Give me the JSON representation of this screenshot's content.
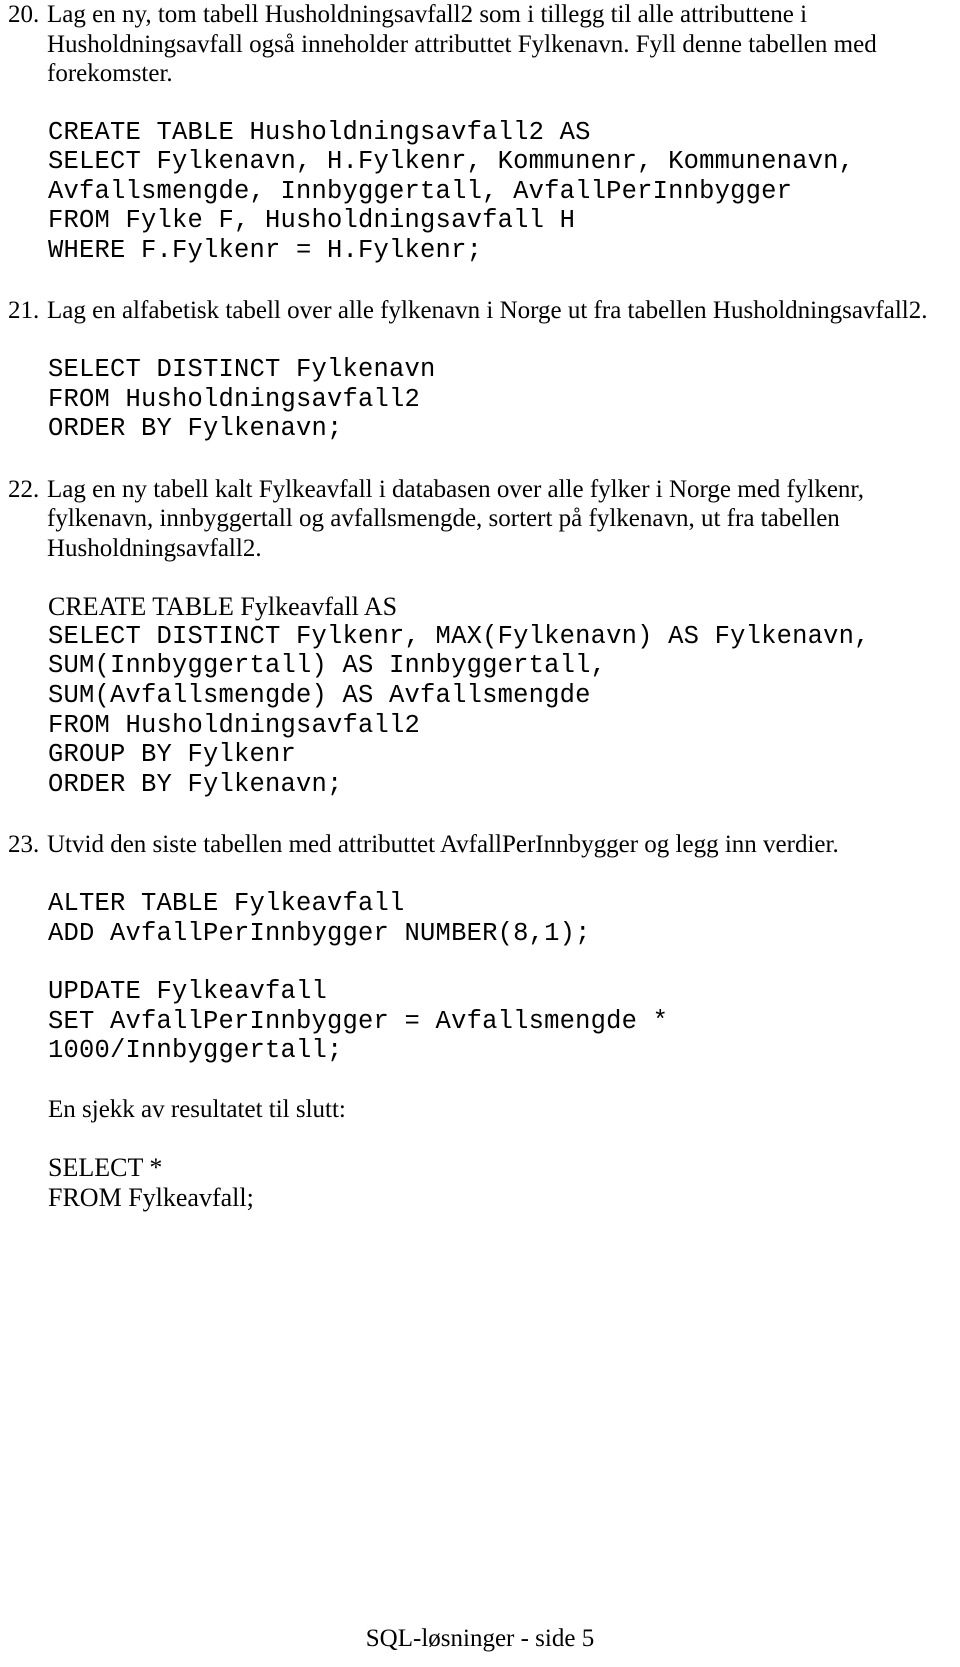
{
  "document": {
    "footer_text": "SQL-løsninger - side 5",
    "text_color": "#000000",
    "background_color": "#ffffff"
  },
  "items": [
    {
      "number": "20.",
      "prompt_lines": [
        "Lag en ny, tom tabell Husholdningsavfall2 som i tillegg til alle attributtene i",
        "Husholdningsavfall også inneholder attributtet Fylkenavn. Fyll denne tabellen",
        "med forekomster."
      ],
      "prompt": "Lag en ny, tom tabell Husholdningsavfall2 som i tillegg til alle attributtene i Husholdningsavfall også inneholder attributtet Fylkenavn. Fyll denne tabellen med forekomster.",
      "code": "CREATE TABLE Husholdningsavfall2 AS\nSELECT Fylkenavn, H.Fylkenr, Kommunenr, Kommunenavn,\nAvfallsmengde, Innbyggertall, AvfallPerInnbygger\nFROM Fylke F, Husholdningsavfall H\nWHERE F.Fylkenr = H.Fylkenr;"
    },
    {
      "number": "21.",
      "prompt_lines": [
        "Lag en alfabetisk tabell over alle fylkenavn i Norge ut fra tabellen",
        "Husholdningsavfall2."
      ],
      "prompt": "Lag en alfabetisk tabell over alle fylkenavn i Norge ut fra tabellen Husholdningsavfall2.",
      "code": "SELECT DISTINCT Fylkenavn\nFROM Husholdningsavfall2\nORDER BY Fylkenavn;"
    },
    {
      "number": "22.",
      "prompt_lines": [
        "Lag en ny tabell kalt Fylkeavfall i databasen over alle fylker i Norge med fylkenr,",
        "fylkenavn, innbyggertall og avfallsmengde, sortert på fylkenavn, ut fra tabellen",
        "Husholdningsavfall2."
      ],
      "prompt": "Lag en ny tabell kalt Fylkeavfall i databasen over alle fylker i Norge med fylkenr, fylkenavn, innbyggertall og avfallsmengde, sortert på fylkenavn, ut fra tabellen Husholdningsavfall2.",
      "code_header": "CREATE TABLE Fylkeavfall AS",
      "code": "SELECT DISTINCT Fylkenr, MAX(Fylkenavn) AS Fylkenavn,\nSUM(Innbyggertall) AS Innbyggertall,\nSUM(Avfallsmengde) AS Avfallsmengde\nFROM Husholdningsavfall2\nGROUP BY Fylkenr\nORDER BY Fylkenavn;"
    },
    {
      "number": "23.",
      "prompt_lines": [
        "Utvid den siste tabellen med attributtet AvfallPerInnbygger og legg inn verdier."
      ],
      "prompt": "Utvid den siste tabellen med attributtet AvfallPerInnbygger og legg inn verdier.",
      "code_alter": "ALTER TABLE Fylkeavfall\nADD AvfallPerInnbygger NUMBER(8,1);",
      "code_update": "UPDATE Fylkeavfall\nSET AvfallPerInnbygger = Avfallsmengde *\n1000/Innbyggertall;",
      "closing_note": "En sjekk av resultatet til slutt:",
      "closing_code": "SELECT *\nFROM Fylkeavfall;"
    }
  ]
}
